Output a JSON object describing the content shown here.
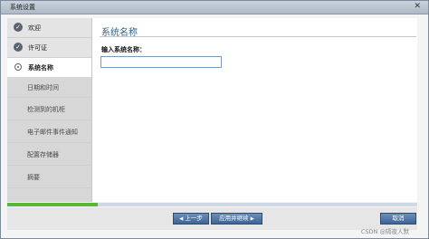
{
  "window": {
    "title": "系统设置",
    "close_symbol": "✕"
  },
  "sidebar": {
    "items": [
      {
        "label": "欢迎",
        "state": "done"
      },
      {
        "label": "许可证",
        "state": "done"
      },
      {
        "label": "系统名称",
        "state": "active"
      },
      {
        "label": "日期和时间",
        "state": "pending"
      },
      {
        "label": "检测到的机柜",
        "state": "pending"
      },
      {
        "label": "电子邮件事件通知",
        "state": "pending"
      },
      {
        "label": "配置存储器",
        "state": "pending"
      },
      {
        "label": "摘要",
        "state": "pending"
      }
    ]
  },
  "main": {
    "title": "系统名称",
    "field_label": "输入系统名称：",
    "field_value": ""
  },
  "progress": {
    "fraction": 0.22,
    "color": "#5ab734"
  },
  "footer": {
    "back_label": "上一步",
    "next_label": "应用并继续",
    "cancel_label": "取消"
  },
  "watermark": "CSDN @隔夜人默",
  "colors": {
    "accent": "#3d6496",
    "title_text": "#2f5f8a"
  }
}
